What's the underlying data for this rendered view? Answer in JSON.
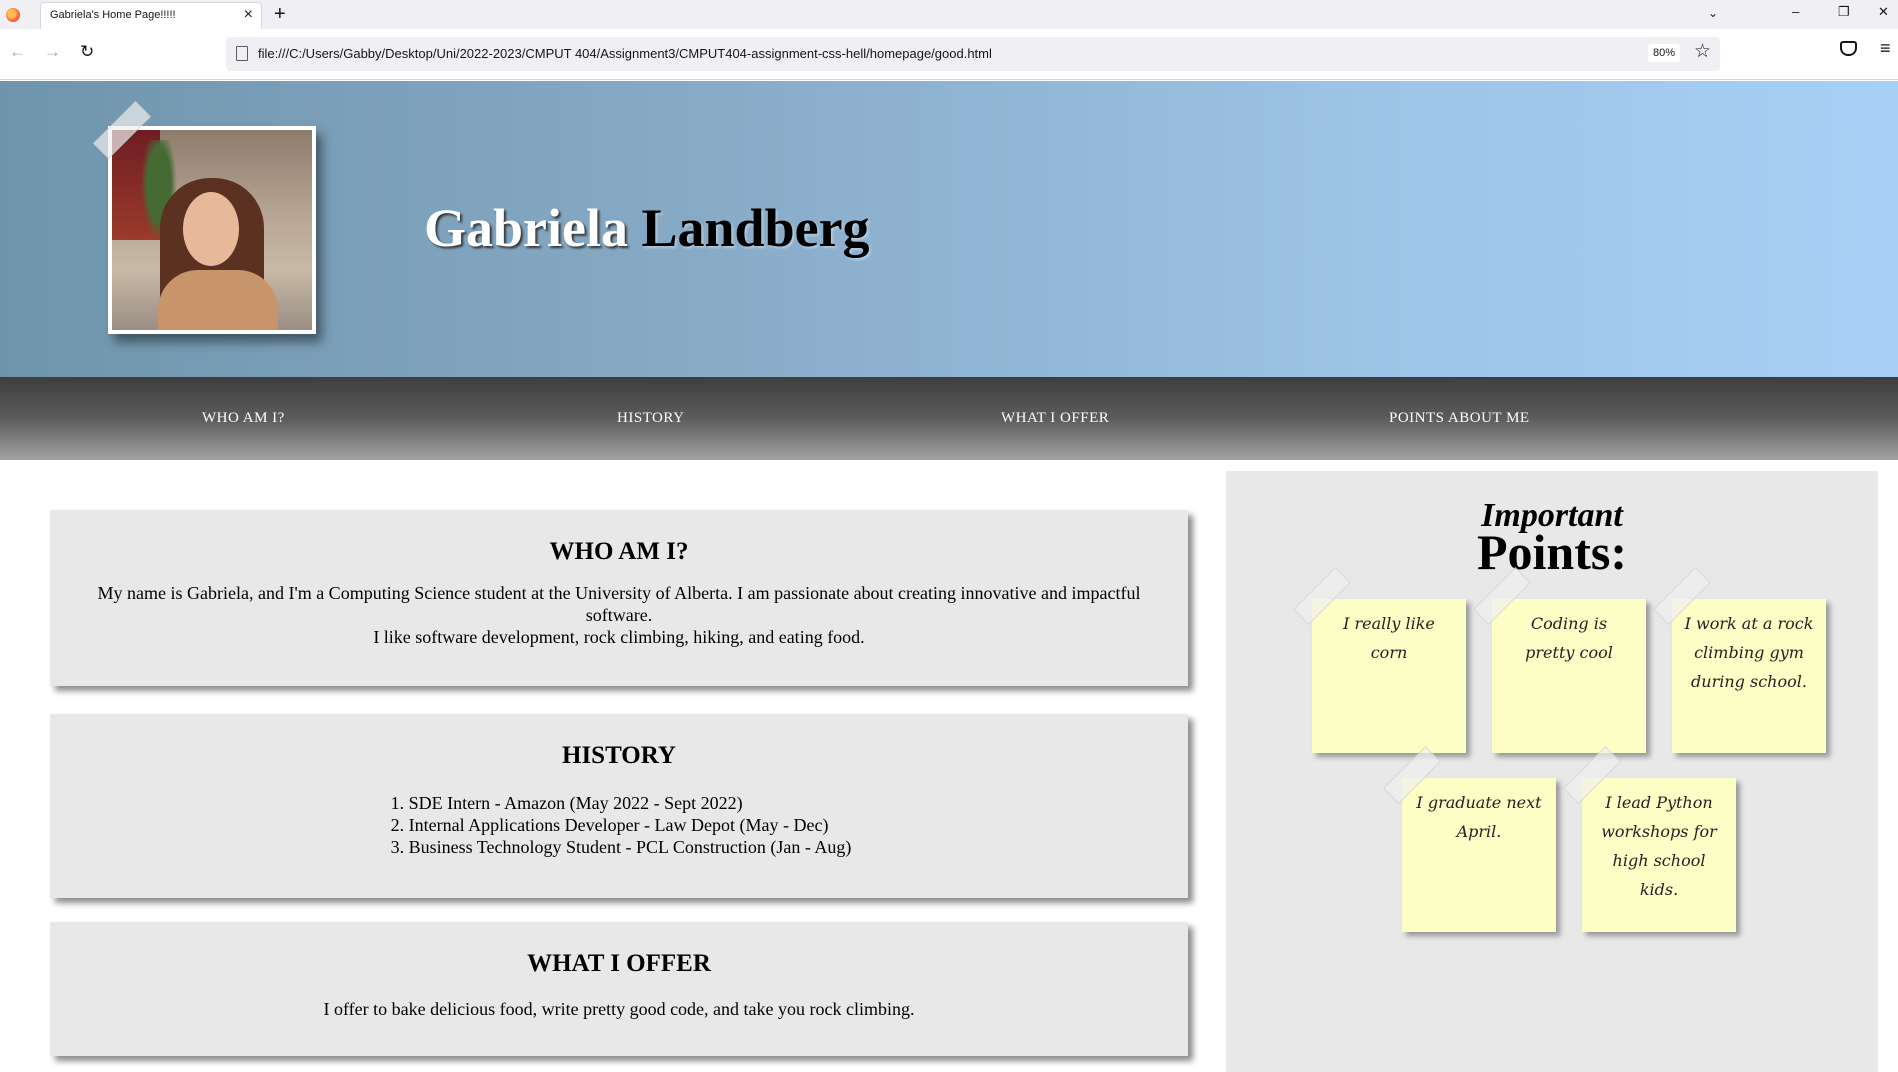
{
  "browser": {
    "tab_title": "Gabriela's Home Page!!!!!",
    "url": "file:///C:/Users/Gabby/Desktop/Uni/2022-2023/CMPUT 404/Assignment3/CMPUT404-assignment-css-hell/homepage/good.html",
    "zoom": "80%",
    "close_glyph": "×",
    "newtab_glyph": "+",
    "tablist_glyph": "⌄",
    "minimize_glyph": "–",
    "restore_glyph": "❐",
    "winclose_glyph": "✕",
    "back_glyph": "←",
    "forward_glyph": "→",
    "reload_glyph": "↻",
    "star_glyph": "☆",
    "menu_glyph": "≡"
  },
  "header": {
    "first_name": "Gabriela",
    "last_name": "Landberg"
  },
  "nav": [
    {
      "label": "WHO AM I?"
    },
    {
      "label": "HISTORY"
    },
    {
      "label": "WHAT I OFFER"
    },
    {
      "label": "POINTS ABOUT ME"
    }
  ],
  "sections": {
    "who": {
      "title": "WHO AM I?",
      "line1": "My name is Gabriela, and I'm a Computing Science student at the University of Alberta. I am passionate about creating innovative and impactful software.",
      "line2": "I like software development, rock climbing, hiking, and eating food."
    },
    "history": {
      "title": "HISTORY",
      "items": [
        "SDE Intern - Amazon (May 2022 - Sept 2022)",
        "Internal Applications Developer - Law Depot (May - Dec)",
        "Business Technology Student - PCL Construction (Jan - Aug)"
      ]
    },
    "offer": {
      "title": "WHAT I OFFER",
      "text": "I offer to bake delicious food, write pretty good code, and take you rock climbing."
    }
  },
  "sidebar": {
    "title_small": "Important",
    "title_big": "Points:",
    "notes": [
      "I really like corn",
      "Coding is pretty cool",
      "I work at a rock climbing gym during school.",
      "I graduate next April.",
      "I lead Python workshops for high school kids."
    ]
  },
  "colors": {
    "header_gradient_start": "#6f95ac",
    "header_gradient_end": "#a8d0f6",
    "card_bg": "#e8e8e8",
    "note_bg": "#fdfdc6"
  }
}
